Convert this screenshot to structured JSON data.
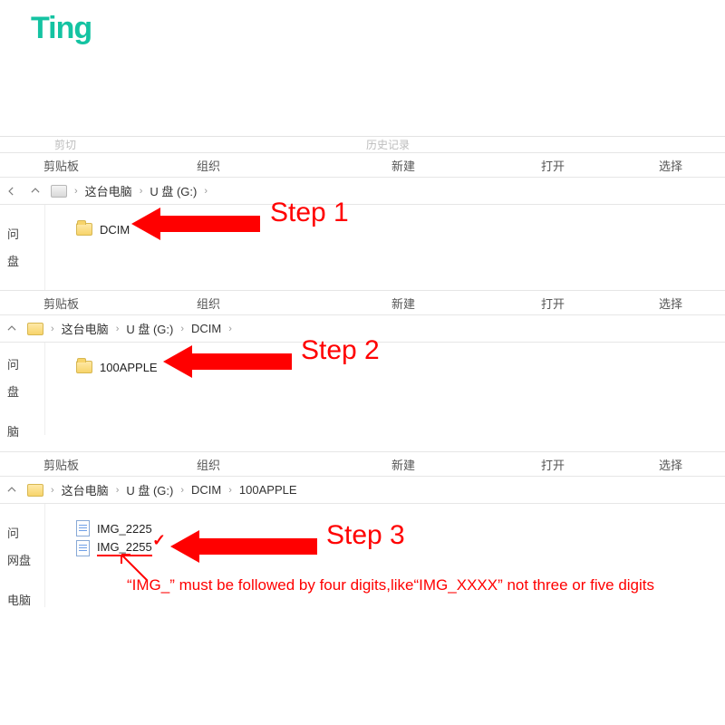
{
  "brand": "Ting",
  "ghost": {
    "left": "剪切",
    "right": "历史记录"
  },
  "tabs": {
    "clipboard": "剪贴板",
    "organize": "组织",
    "new": "新建",
    "open": "打开",
    "select": "选择"
  },
  "nav": {
    "this_pc": "这台电脑",
    "udrive": "U 盘 (G:)",
    "dcim": "DCIM",
    "apple": "100APPLE"
  },
  "side": {
    "access": "问",
    "netdisk": "盘",
    "netdisk2": "网盘",
    "lbl3": "盘",
    "brain": "脑",
    "brain2": "电脑"
  },
  "folders": {
    "dcim": "DCIM",
    "apple": "100APPLE"
  },
  "files": {
    "f1": "IMG_2225",
    "f2": "IMG_2255"
  },
  "steps": {
    "s1": "Step 1",
    "s2": "Step 2",
    "s3": "Step 3"
  },
  "note": "“IMG_” must be followed by four digits,like“IMG_XXXX” not three or five digits"
}
